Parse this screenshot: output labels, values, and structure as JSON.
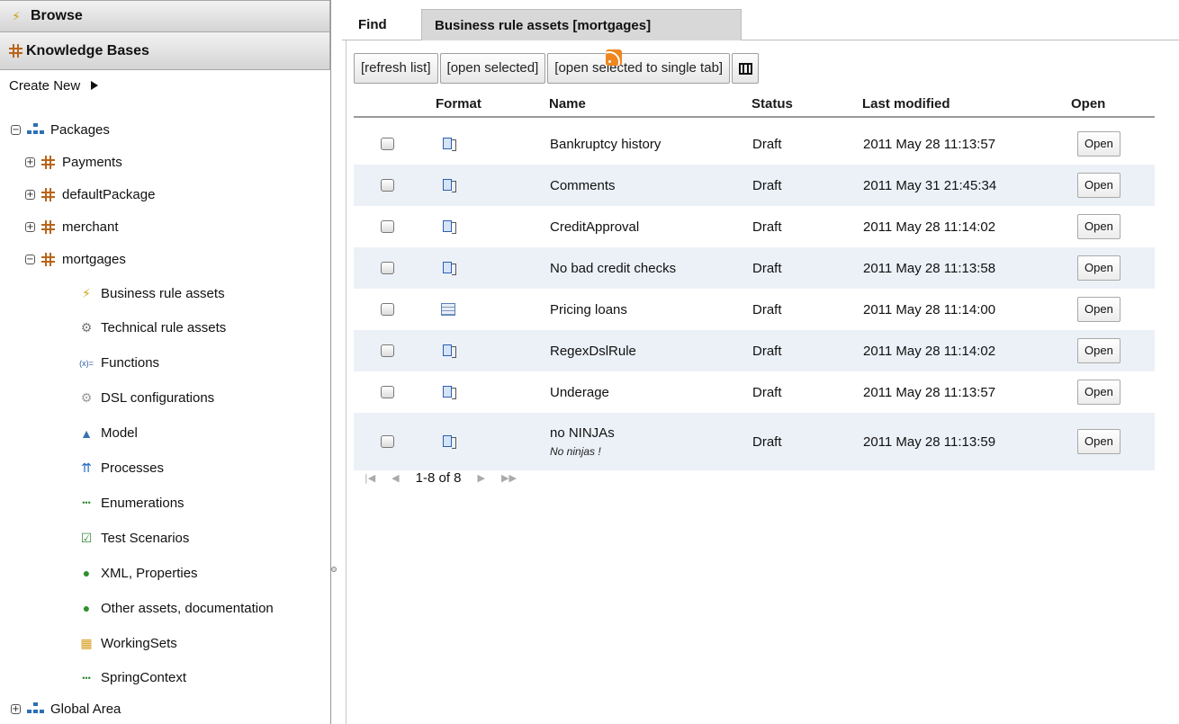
{
  "sidebar": {
    "browse_header": "Browse",
    "kb_header": "Knowledge Bases",
    "create_new": "Create New",
    "packages_label": "Packages",
    "packages": [
      "Payments",
      "defaultPackage",
      "merchant",
      "mortgages"
    ],
    "mortgages_children": [
      {
        "label": "Business rule assets",
        "icon": "lightning-icon"
      },
      {
        "label": "Technical rule assets",
        "icon": "gears-icon"
      },
      {
        "label": "Functions",
        "icon": "function-icon"
      },
      {
        "label": "DSL configurations",
        "icon": "gear-icon"
      },
      {
        "label": "Model",
        "icon": "model-icon"
      },
      {
        "label": "Processes",
        "icon": "process-icon"
      },
      {
        "label": "Enumerations",
        "icon": "enumeration-icon"
      },
      {
        "label": "Test Scenarios",
        "icon": "test-scenario-icon"
      },
      {
        "label": "XML, Properties",
        "icon": "xml-icon"
      },
      {
        "label": "Other assets, documentation",
        "icon": "document-icon"
      },
      {
        "label": "WorkingSets",
        "icon": "workingsets-icon"
      },
      {
        "label": "SpringContext",
        "icon": "spring-icon"
      }
    ],
    "global_area": "Global Area"
  },
  "tabs": {
    "find": "Find",
    "active": "Business rule assets [mortgages]"
  },
  "toolbar": {
    "refresh": "[refresh list]",
    "open_selected": "[open selected]",
    "open_single": "[open selected to single tab]"
  },
  "table": {
    "headers": {
      "format": "Format",
      "name": "Name",
      "status": "Status",
      "modified": "Last modified",
      "open": "Open"
    },
    "open_label": "Open",
    "rows": [
      {
        "format": "rule",
        "name": "Bankruptcy history",
        "desc": "",
        "status": "Draft",
        "modified": "2011 May 28 11:13:57"
      },
      {
        "format": "rule",
        "name": "Comments",
        "desc": "",
        "status": "Draft",
        "modified": "2011 May 31 21:45:34"
      },
      {
        "format": "rule",
        "name": "CreditApproval",
        "desc": "",
        "status": "Draft",
        "modified": "2011 May 28 11:14:02"
      },
      {
        "format": "rule",
        "name": "No bad credit checks",
        "desc": "",
        "status": "Draft",
        "modified": "2011 May 28 11:13:58"
      },
      {
        "format": "table",
        "name": "Pricing loans",
        "desc": "",
        "status": "Draft",
        "modified": "2011 May 28 11:14:00"
      },
      {
        "format": "rule",
        "name": "RegexDslRule",
        "desc": "",
        "status": "Draft",
        "modified": "2011 May 28 11:14:02"
      },
      {
        "format": "rule",
        "name": "Underage",
        "desc": "",
        "status": "Draft",
        "modified": "2011 May 28 11:13:57"
      },
      {
        "format": "rule",
        "name": "no NINJAs",
        "desc": "No ninjas !",
        "status": "Draft",
        "modified": "2011 May 28 11:13:59"
      }
    ]
  },
  "pager": {
    "range": "1-8 of 8"
  },
  "colors": {
    "alt_row": "#ecf1f8",
    "rss": "#f0861e"
  }
}
